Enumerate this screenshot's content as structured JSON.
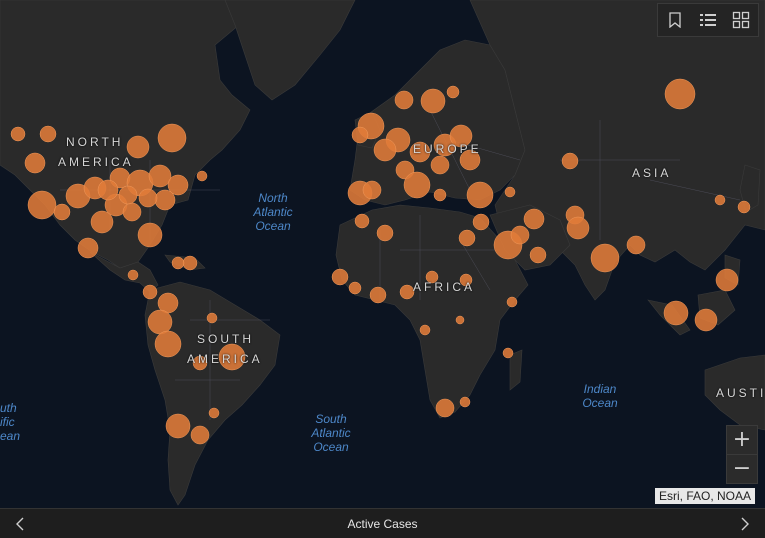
{
  "map": {
    "continents": [
      {
        "id": "north-america",
        "line1": "NORTH",
        "line2": "AMERICA"
      },
      {
        "id": "europe",
        "line1": "EUROPE"
      },
      {
        "id": "asia",
        "line1": "ASIA"
      },
      {
        "id": "africa",
        "line1": "AFRICA"
      },
      {
        "id": "south-america",
        "line1": "SOUTH",
        "line2": "AMERICA"
      },
      {
        "id": "australia",
        "line1": "AUSTI"
      }
    ],
    "oceans": [
      {
        "id": "north-atlantic",
        "line1": "North",
        "line2": "Atlantic",
        "line3": "Ocean"
      },
      {
        "id": "south-atlantic",
        "line1": "South",
        "line2": "Atlantic",
        "line3": "Ocean"
      },
      {
        "id": "indian",
        "line1": "Indian",
        "line2": "Ocean"
      },
      {
        "id": "south-pacific",
        "line1": "uth",
        "line2": "ific",
        "line3": "ean"
      }
    ],
    "bubble_color": "#e07b39",
    "land_color": "#2a2a2a",
    "ocean_color": "#0c1421"
  },
  "toolbar": {
    "icons": [
      "bookmark-icon",
      "legend-list-icon",
      "basemap-gallery-icon"
    ]
  },
  "zoom": {
    "in_label": "+",
    "out_label": "−"
  },
  "attribution": "Esri, FAO, NOAA",
  "footer": {
    "title": "Active Cases"
  }
}
